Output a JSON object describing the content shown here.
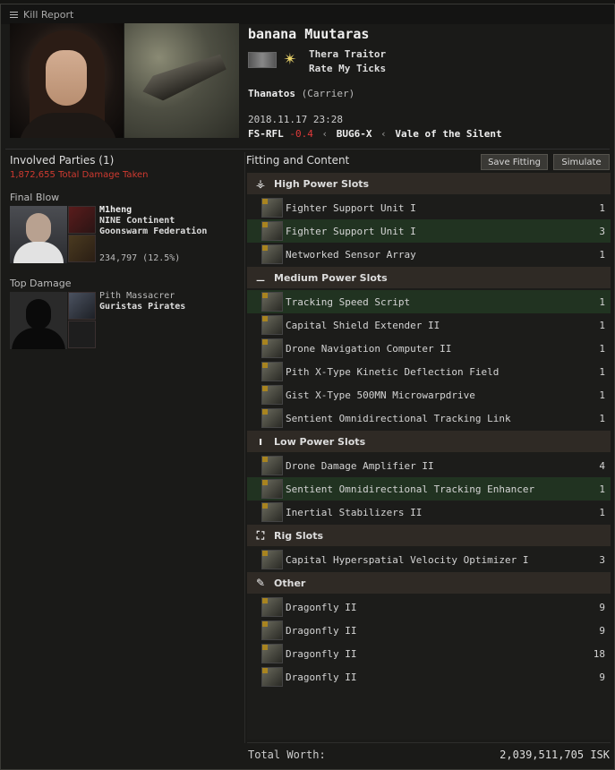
{
  "window": {
    "title": "Kill Report"
  },
  "victim": {
    "name": "banana Muutaras",
    "corporation": "Thera Traitor",
    "alliance": "Rate My Ticks",
    "ship": "Thanatos",
    "ship_class": "(Carrier)",
    "datetime": "2018.11.17  23:28",
    "system": "FS-RFL",
    "security": "-0.4",
    "constellation": "BUG6-X",
    "region": "Vale of the Silent",
    "separator": "‹"
  },
  "involved": {
    "title": "Involved Parties (1)",
    "damage_taken": "1,872,655 Total Damage Taken",
    "final_blow_label": "Final Blow",
    "final_blow": {
      "name": "M1heng",
      "corporation": "NINE Continent",
      "alliance": "Goonswarm Federation",
      "damage": "234,797 (12.5%)"
    },
    "top_damage_label": "Top Damage",
    "top_damage": {
      "name": "Pith Massacrer",
      "corporation": "Guristas Pirates"
    }
  },
  "fitting": {
    "title": "Fitting and Content",
    "save_label": "Save Fitting",
    "simulate_label": "Simulate",
    "sections": [
      {
        "label": "High Power Slots",
        "icon": "high-slot-icon",
        "items": [
          {
            "name": "Fighter Support Unit I",
            "qty": "1",
            "dropped": false
          },
          {
            "name": "Fighter Support Unit I",
            "qty": "3",
            "dropped": true
          },
          {
            "name": "Networked Sensor Array",
            "qty": "1",
            "dropped": false
          }
        ]
      },
      {
        "label": "Medium Power Slots",
        "icon": "mid-slot-icon",
        "items": [
          {
            "name": "Tracking Speed Script",
            "qty": "1",
            "dropped": true
          },
          {
            "name": "Capital Shield Extender II",
            "qty": "1",
            "dropped": false
          },
          {
            "name": "Drone Navigation Computer II",
            "qty": "1",
            "dropped": false
          },
          {
            "name": "Pith X-Type Kinetic Deflection Field",
            "qty": "1",
            "dropped": false
          },
          {
            "name": "Gist X-Type 500MN Microwarpdrive",
            "qty": "1",
            "dropped": false
          },
          {
            "name": "Sentient Omnidirectional Tracking Link",
            "qty": "1",
            "dropped": false
          }
        ]
      },
      {
        "label": "Low Power Slots",
        "icon": "low-slot-icon",
        "items": [
          {
            "name": "Drone Damage Amplifier II",
            "qty": "4",
            "dropped": false
          },
          {
            "name": "Sentient Omnidirectional Tracking Enhancer",
            "qty": "1",
            "dropped": true
          },
          {
            "name": "Inertial Stabilizers II",
            "qty": "1",
            "dropped": false
          }
        ]
      },
      {
        "label": "Rig Slots",
        "icon": "rig-slot-icon",
        "items": [
          {
            "name": "Capital Hyperspatial Velocity Optimizer I",
            "qty": "3",
            "dropped": false
          }
        ]
      },
      {
        "label": "Other",
        "icon": "other-cargo-icon",
        "items": [
          {
            "name": "Dragonfly II",
            "qty": "9",
            "dropped": false
          },
          {
            "name": "Dragonfly II",
            "qty": "9",
            "dropped": false
          },
          {
            "name": "Dragonfly II",
            "qty": "18",
            "dropped": false
          },
          {
            "name": "Dragonfly II",
            "qty": "9",
            "dropped": false
          }
        ]
      }
    ]
  },
  "total": {
    "label": "Total Worth:",
    "value": "2,039,511,705 ISK"
  },
  "colors": {
    "security_negative": "#e03a3a",
    "dropped_row": "#213321",
    "damage_text": "#d03a30"
  }
}
